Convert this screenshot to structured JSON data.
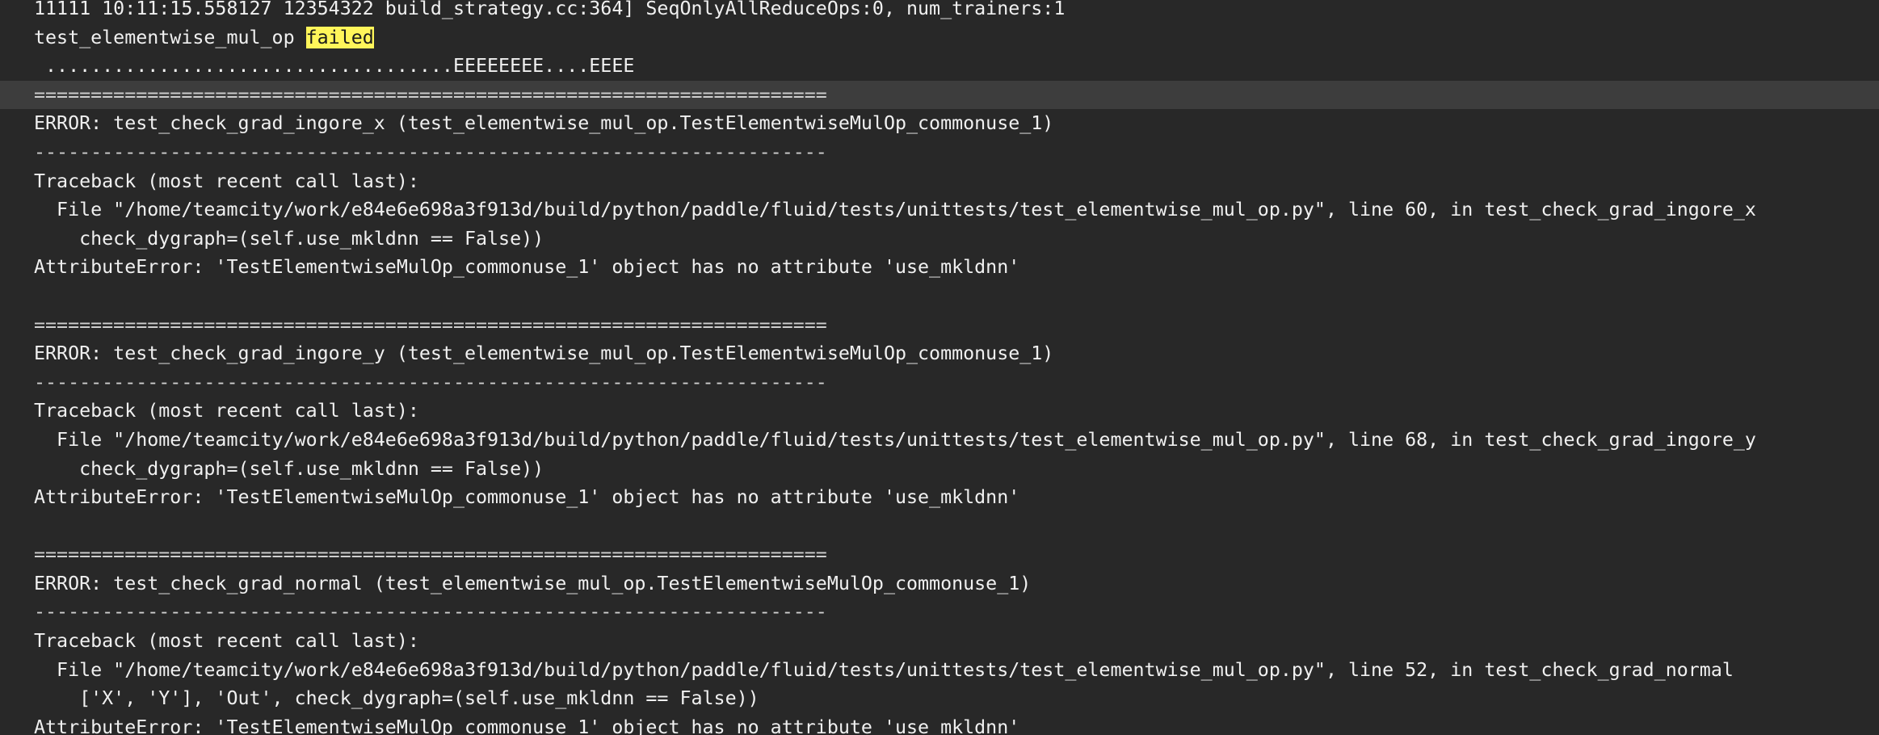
{
  "terminal": {
    "lines": [
      {
        "text": "11111 10:11:15.558127 12354322 build_strategy.cc:364] SeqOnlyAllReduceOps:0, num_trainers:1"
      },
      {
        "text": "test_elementwise_mul_op ",
        "highlight": "failed"
      },
      {
        "text": " ....................................EEEEEEEE....EEEE"
      },
      {
        "text": "======================================================================",
        "selected": true
      },
      {
        "text": "ERROR: test_check_grad_ingore_x (test_elementwise_mul_op.TestElementwiseMulOp_commonuse_1)"
      },
      {
        "text": "----------------------------------------------------------------------"
      },
      {
        "text": "Traceback (most recent call last):"
      },
      {
        "text": "  File \"/home/teamcity/work/e84e6e698a3f913d/build/python/paddle/fluid/tests/unittests/test_elementwise_mul_op.py\", line 60, in test_check_grad_ingore_x"
      },
      {
        "text": "    check_dygraph=(self.use_mkldnn == False))"
      },
      {
        "text": "AttributeError: 'TestElementwiseMulOp_commonuse_1' object has no attribute 'use_mkldnn'"
      },
      {
        "text": ""
      },
      {
        "text": "======================================================================"
      },
      {
        "text": "ERROR: test_check_grad_ingore_y (test_elementwise_mul_op.TestElementwiseMulOp_commonuse_1)"
      },
      {
        "text": "----------------------------------------------------------------------"
      },
      {
        "text": "Traceback (most recent call last):"
      },
      {
        "text": "  File \"/home/teamcity/work/e84e6e698a3f913d/build/python/paddle/fluid/tests/unittests/test_elementwise_mul_op.py\", line 68, in test_check_grad_ingore_y"
      },
      {
        "text": "    check_dygraph=(self.use_mkldnn == False))"
      },
      {
        "text": "AttributeError: 'TestElementwiseMulOp_commonuse_1' object has no attribute 'use_mkldnn'"
      },
      {
        "text": ""
      },
      {
        "text": "======================================================================"
      },
      {
        "text": "ERROR: test_check_grad_normal (test_elementwise_mul_op.TestElementwiseMulOp_commonuse_1)"
      },
      {
        "text": "----------------------------------------------------------------------"
      },
      {
        "text": "Traceback (most recent call last):"
      },
      {
        "text": "  File \"/home/teamcity/work/e84e6e698a3f913d/build/python/paddle/fluid/tests/unittests/test_elementwise_mul_op.py\", line 52, in test_check_grad_normal"
      },
      {
        "text": "    ['X', 'Y'], 'Out', check_dygraph=(self.use_mkldnn == False))"
      },
      {
        "text": "AttributeError: 'TestElementwiseMulOp_commonuse_1' object has no attribute 'use_mkldnn'"
      }
    ]
  }
}
